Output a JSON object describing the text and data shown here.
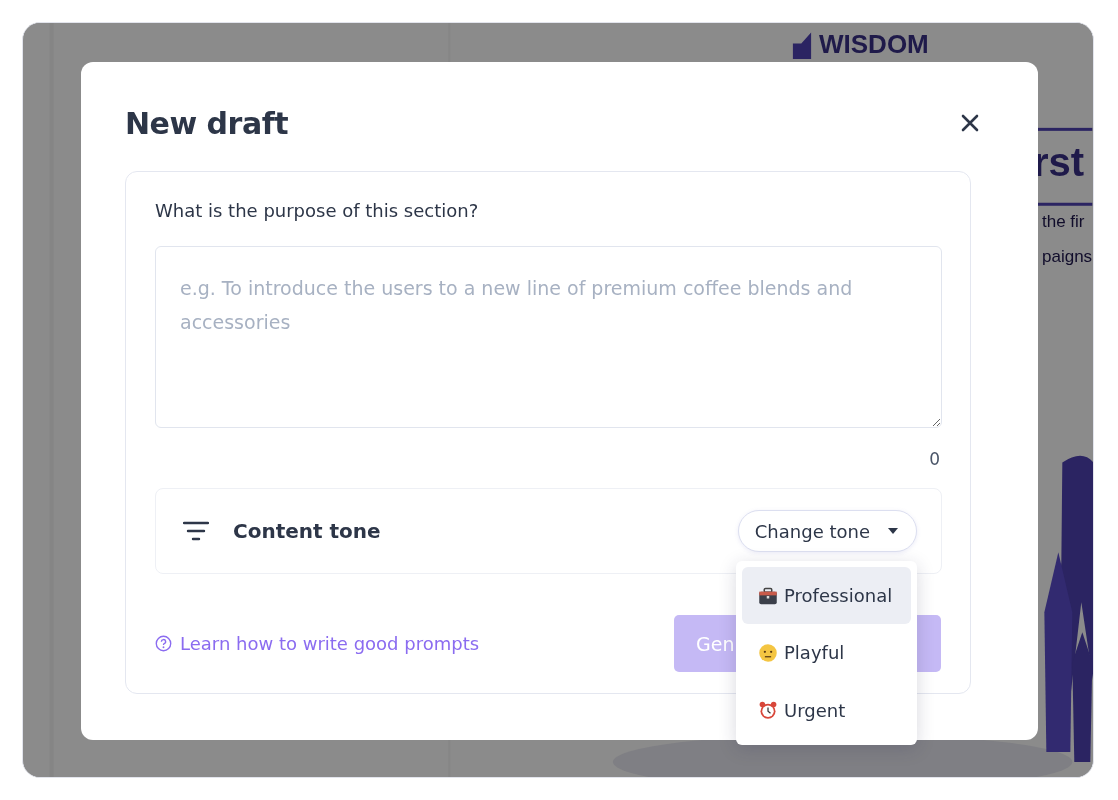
{
  "background": {
    "logo": "WISDOM",
    "heading": "rst",
    "lines": [
      "the fir",
      "paigns"
    ]
  },
  "dialog": {
    "title": "New draft",
    "purpose": {
      "label": "What is the purpose of this section?",
      "placeholder": "e.g. To introduce the users to a new line of premium coffee blends and accessories",
      "counter": "0"
    },
    "tone": {
      "label": "Content tone",
      "button": "Change tone",
      "menu": [
        {
          "label": "Professional",
          "selected": true
        },
        {
          "label": "Playful",
          "selected": false
        },
        {
          "label": "Urgent",
          "selected": false
        }
      ]
    },
    "help_link": "Learn how to write good prompts",
    "generate_button": "Gen"
  }
}
